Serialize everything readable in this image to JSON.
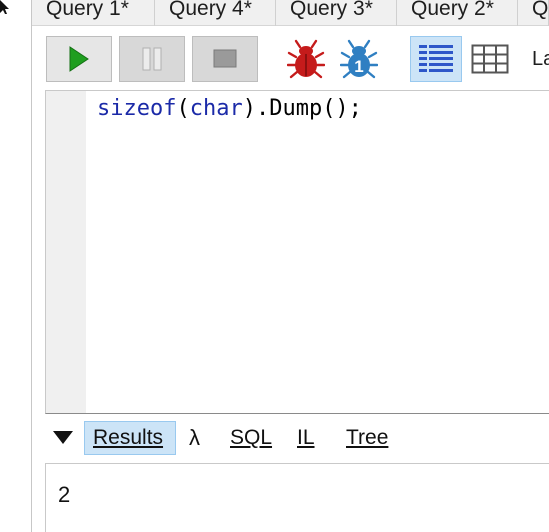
{
  "tabs": [
    {
      "label": "Query 1*"
    },
    {
      "label": "Query 4*"
    },
    {
      "label": "Query 3*"
    },
    {
      "label": "Query 2*"
    },
    {
      "label": "Q"
    }
  ],
  "toolbar": {
    "run_icon": "play-icon",
    "pause_icon": "pause-icon",
    "stop_icon": "stop-icon",
    "debug_icon": "bug-icon",
    "debug_one_icon": "bug-one-icon",
    "debug_one_badge": "1",
    "rich_text_icon": "rich-text-results-icon",
    "grid_icon": "data-grid-icon",
    "language_label": "La"
  },
  "editor": {
    "keyword_sizeof": "sizeof",
    "open_paren": "(",
    "keyword_char": "char",
    "rest": ").Dump();"
  },
  "results_bar": {
    "collapse_icon": "triangle-down-icon",
    "results_label": "Results",
    "lambda_label": "λ",
    "sql_label": "SQL",
    "il_label": "IL",
    "tree_label": "Tree"
  },
  "output": {
    "value": "2"
  },
  "colors": {
    "accent_selected": "#cce4f7",
    "keyword": "#1b2aa8",
    "run_green": "#1f9e1f",
    "bug_red": "#c51b1b",
    "bug_blue": "#2f7fc2"
  }
}
